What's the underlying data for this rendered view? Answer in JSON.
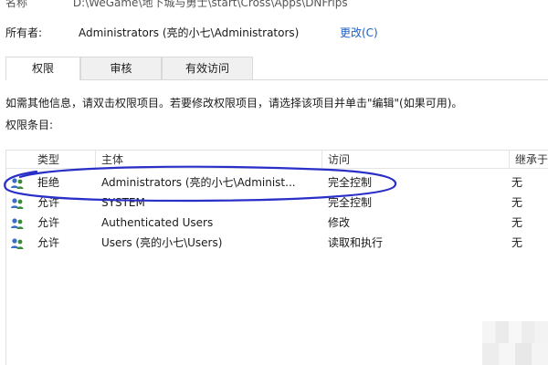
{
  "properties": {
    "name_label": "名称",
    "name_value": "D:\\WeGame\\地下城与勇士\\start\\Cross\\Apps\\DNFrips",
    "owner_label": "所有者:",
    "owner_value": "Administrators (亮的小七\\Administrators)",
    "change_link": "更改(C)"
  },
  "tabs": [
    {
      "label": "权限",
      "active": true
    },
    {
      "label": "审核",
      "active": false
    },
    {
      "label": "有效访问",
      "active": false
    }
  ],
  "hint_text": "如需其他信息，请双击权限项目。若要修改权限项目，请选择该项目并单击\"编辑\"(如果可用)。",
  "entries_label": "权限条目:",
  "table": {
    "columns": [
      "类型",
      "主体",
      "访问",
      "继承于"
    ],
    "rows": [
      {
        "type": "拒绝",
        "principal": "Administrators (亮的小七\\Administ...",
        "access": "完全控制",
        "inherited": "无"
      },
      {
        "type": "允许",
        "principal": "SYSTEM",
        "access": "完全控制",
        "inherited": "无"
      },
      {
        "type": "允许",
        "principal": "Authenticated Users",
        "access": "修改",
        "inherited": "无"
      },
      {
        "type": "允许",
        "principal": "Users (亮的小七\\Users)",
        "access": "读取和执行",
        "inherited": "无"
      }
    ]
  },
  "colors": {
    "link": "#1a5fc8",
    "annotation": "#2a2fc8",
    "icon_user_green": "#3a8a3a",
    "icon_user_blue": "#3b6fc4"
  },
  "icons": {
    "row_icon": "users-group-icon"
  }
}
